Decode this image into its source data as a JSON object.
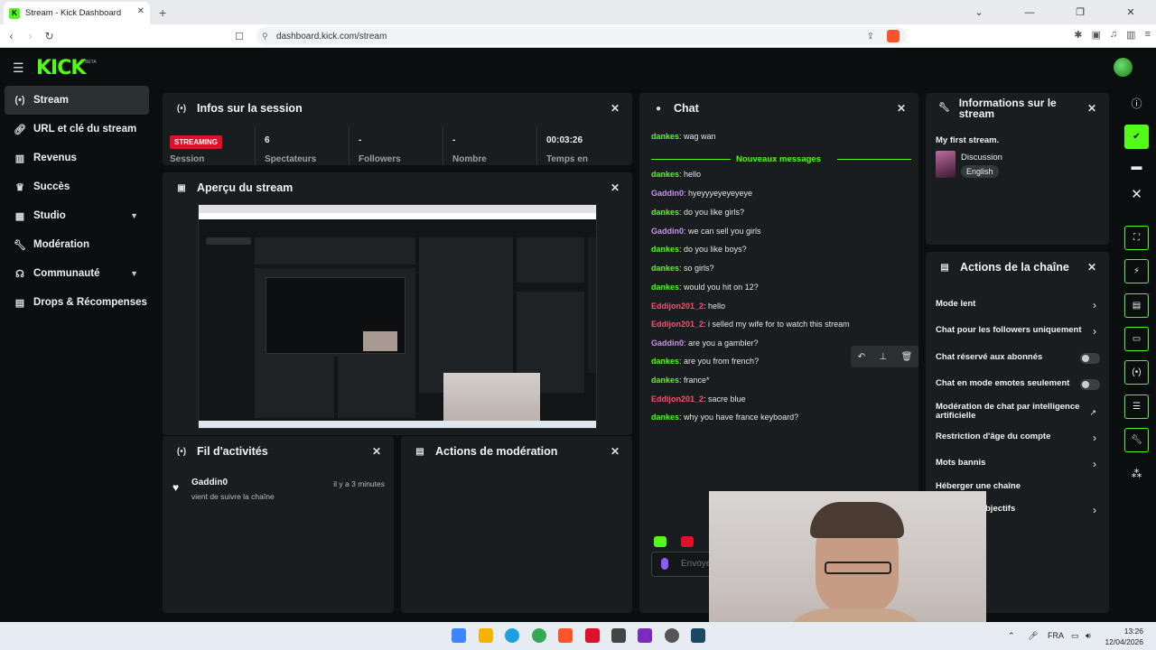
{
  "browser": {
    "tab_title": "Stream - Kick Dashboard",
    "url": "dashboard.kick.com/stream"
  },
  "app": {
    "logo": "KICK",
    "beta": "BETA"
  },
  "sidebar": {
    "items": [
      {
        "label": "Stream",
        "icon": "broadcast-icon"
      },
      {
        "label": "URL et clé du stream",
        "icon": "link-icon"
      },
      {
        "label": "Revenus",
        "icon": "chart-icon"
      },
      {
        "label": "Succès",
        "icon": "trophy-icon"
      },
      {
        "label": "Studio",
        "icon": "studio-icon"
      },
      {
        "label": "Modération",
        "icon": "wrench-icon"
      },
      {
        "label": "Communauté",
        "icon": "community-icon"
      },
      {
        "label": "Drops & Récompenses",
        "icon": "gift-icon"
      }
    ]
  },
  "session": {
    "title": "Infos sur la session",
    "badge": "STREAMING",
    "badge_label": "Session",
    "stats": [
      {
        "value": "6",
        "label": "Spectateurs"
      },
      {
        "value": "-",
        "label": "Followers"
      },
      {
        "value": "-",
        "label": "Nombre"
      },
      {
        "value": "00:03:26",
        "label": "Temps en"
      }
    ]
  },
  "preview": {
    "title": "Aperçu du stream"
  },
  "activity": {
    "title": "Fil d'activités",
    "items": [
      {
        "user": "Gaddin0",
        "action": "vient de suivre la chaîne",
        "time": "il y a 3 minutes"
      }
    ]
  },
  "modactions": {
    "title": "Actions de modération"
  },
  "chat": {
    "title": "Chat",
    "new_messages": "Nouveaux messages",
    "input_placeholder": "Envoyer",
    "messages": [
      {
        "user": "dankes",
        "text": ": wag wan",
        "color": "#53fc18"
      },
      {
        "user": "dankes",
        "text": ": hello",
        "color": "#53fc18"
      },
      {
        "user": "Gaddin0",
        "text": ": hyeyyyeyeyeyeye",
        "color": "#c792ea"
      },
      {
        "user": "dankes",
        "text": ": do you like girls?",
        "color": "#53fc18"
      },
      {
        "user": "Gaddin0",
        "text": ": we can sell you girls",
        "color": "#c792ea"
      },
      {
        "user": "dankes",
        "text": ": do you like boys?",
        "color": "#53fc18"
      },
      {
        "user": "dankes",
        "text": ": so girls?",
        "color": "#53fc18"
      },
      {
        "user": "dankes",
        "text": ": would you hit on 12?",
        "color": "#53fc18"
      },
      {
        "user": "Eddijon201_2",
        "text": ": hello",
        "color": "#ff4d6d"
      },
      {
        "user": "Eddijon201_2",
        "text": ": i selled my wife for to watch this stream",
        "color": "#ff4d6d"
      },
      {
        "user": "Gaddin0",
        "text": ": are you a gambler?",
        "color": "#c792ea"
      },
      {
        "user": "dankes",
        "text": ": are you from french?",
        "color": "#53fc18"
      },
      {
        "user": "dankes",
        "text": ": france*",
        "color": "#53fc18"
      },
      {
        "user": "Eddijon201_2",
        "text": ": sacre blue",
        "color": "#ff4d6d"
      },
      {
        "user": "dankes",
        "text": ": why you have france keyboard?",
        "color": "#53fc18"
      }
    ]
  },
  "streaminfo": {
    "title": "Informations sur le stream",
    "stream_title": "My first stream.",
    "category": "Discussion",
    "language": "English"
  },
  "channel": {
    "title": "Actions de la chaîne",
    "rows": [
      {
        "label": "Mode lent",
        "control": "chevron"
      },
      {
        "label": "Chat pour les followers uniquement",
        "control": "chevron"
      },
      {
        "label": "Chat réservé aux abonnés",
        "control": "toggle"
      },
      {
        "label": "Chat en mode emotes seulement",
        "control": "toggle"
      },
      {
        "label": "Modération de chat par intelligence artificielle",
        "control": "external"
      },
      {
        "label": "Restriction d'âge du compte",
        "control": "chevron"
      },
      {
        "label": "Mots bannis",
        "control": "chevron"
      },
      {
        "label": "Héberger une chaîne",
        "control": "none"
      },
      {
        "label": "bjectifs",
        "control": "chevron"
      }
    ]
  },
  "taskbar": {
    "lang": "FRA",
    "time": "13:26",
    "date": "12/04/2026"
  },
  "colors": {
    "accent": "#53fc18",
    "panel": "#1a1d1f",
    "bg": "#0b0e0f",
    "live": "#e0102b"
  }
}
